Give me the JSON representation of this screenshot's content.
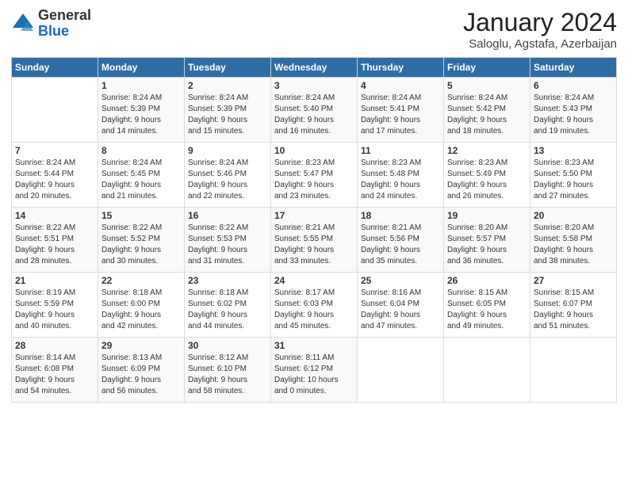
{
  "logo": {
    "general": "General",
    "blue": "Blue"
  },
  "header": {
    "month": "January 2024",
    "location": "Saloglu, Agstafa, Azerbaijan"
  },
  "days_header": [
    "Sunday",
    "Monday",
    "Tuesday",
    "Wednesday",
    "Thursday",
    "Friday",
    "Saturday"
  ],
  "weeks": [
    [
      {
        "day": "",
        "sunrise": "",
        "sunset": "",
        "daylight": ""
      },
      {
        "day": "1",
        "sunrise": "Sunrise: 8:24 AM",
        "sunset": "Sunset: 5:39 PM",
        "daylight": "Daylight: 9 hours and 14 minutes."
      },
      {
        "day": "2",
        "sunrise": "Sunrise: 8:24 AM",
        "sunset": "Sunset: 5:39 PM",
        "daylight": "Daylight: 9 hours and 15 minutes."
      },
      {
        "day": "3",
        "sunrise": "Sunrise: 8:24 AM",
        "sunset": "Sunset: 5:40 PM",
        "daylight": "Daylight: 9 hours and 16 minutes."
      },
      {
        "day": "4",
        "sunrise": "Sunrise: 8:24 AM",
        "sunset": "Sunset: 5:41 PM",
        "daylight": "Daylight: 9 hours and 17 minutes."
      },
      {
        "day": "5",
        "sunrise": "Sunrise: 8:24 AM",
        "sunset": "Sunset: 5:42 PM",
        "daylight": "Daylight: 9 hours and 18 minutes."
      },
      {
        "day": "6",
        "sunrise": "Sunrise: 8:24 AM",
        "sunset": "Sunset: 5:43 PM",
        "daylight": "Daylight: 9 hours and 19 minutes."
      }
    ],
    [
      {
        "day": "7",
        "sunrise": "Sunrise: 8:24 AM",
        "sunset": "Sunset: 5:44 PM",
        "daylight": "Daylight: 9 hours and 20 minutes."
      },
      {
        "day": "8",
        "sunrise": "Sunrise: 8:24 AM",
        "sunset": "Sunset: 5:45 PM",
        "daylight": "Daylight: 9 hours and 21 minutes."
      },
      {
        "day": "9",
        "sunrise": "Sunrise: 8:24 AM",
        "sunset": "Sunset: 5:46 PM",
        "daylight": "Daylight: 9 hours and 22 minutes."
      },
      {
        "day": "10",
        "sunrise": "Sunrise: 8:23 AM",
        "sunset": "Sunset: 5:47 PM",
        "daylight": "Daylight: 9 hours and 23 minutes."
      },
      {
        "day": "11",
        "sunrise": "Sunrise: 8:23 AM",
        "sunset": "Sunset: 5:48 PM",
        "daylight": "Daylight: 9 hours and 24 minutes."
      },
      {
        "day": "12",
        "sunrise": "Sunrise: 8:23 AM",
        "sunset": "Sunset: 5:49 PM",
        "daylight": "Daylight: 9 hours and 26 minutes."
      },
      {
        "day": "13",
        "sunrise": "Sunrise: 8:23 AM",
        "sunset": "Sunset: 5:50 PM",
        "daylight": "Daylight: 9 hours and 27 minutes."
      }
    ],
    [
      {
        "day": "14",
        "sunrise": "Sunrise: 8:22 AM",
        "sunset": "Sunset: 5:51 PM",
        "daylight": "Daylight: 9 hours and 28 minutes."
      },
      {
        "day": "15",
        "sunrise": "Sunrise: 8:22 AM",
        "sunset": "Sunset: 5:52 PM",
        "daylight": "Daylight: 9 hours and 30 minutes."
      },
      {
        "day": "16",
        "sunrise": "Sunrise: 8:22 AM",
        "sunset": "Sunset: 5:53 PM",
        "daylight": "Daylight: 9 hours and 31 minutes."
      },
      {
        "day": "17",
        "sunrise": "Sunrise: 8:21 AM",
        "sunset": "Sunset: 5:55 PM",
        "daylight": "Daylight: 9 hours and 33 minutes."
      },
      {
        "day": "18",
        "sunrise": "Sunrise: 8:21 AM",
        "sunset": "Sunset: 5:56 PM",
        "daylight": "Daylight: 9 hours and 35 minutes."
      },
      {
        "day": "19",
        "sunrise": "Sunrise: 8:20 AM",
        "sunset": "Sunset: 5:57 PM",
        "daylight": "Daylight: 9 hours and 36 minutes."
      },
      {
        "day": "20",
        "sunrise": "Sunrise: 8:20 AM",
        "sunset": "Sunset: 5:58 PM",
        "daylight": "Daylight: 9 hours and 38 minutes."
      }
    ],
    [
      {
        "day": "21",
        "sunrise": "Sunrise: 8:19 AM",
        "sunset": "Sunset: 5:59 PM",
        "daylight": "Daylight: 9 hours and 40 minutes."
      },
      {
        "day": "22",
        "sunrise": "Sunrise: 8:18 AM",
        "sunset": "Sunset: 6:00 PM",
        "daylight": "Daylight: 9 hours and 42 minutes."
      },
      {
        "day": "23",
        "sunrise": "Sunrise: 8:18 AM",
        "sunset": "Sunset: 6:02 PM",
        "daylight": "Daylight: 9 hours and 44 minutes."
      },
      {
        "day": "24",
        "sunrise": "Sunrise: 8:17 AM",
        "sunset": "Sunset: 6:03 PM",
        "daylight": "Daylight: 9 hours and 45 minutes."
      },
      {
        "day": "25",
        "sunrise": "Sunrise: 8:16 AM",
        "sunset": "Sunset: 6:04 PM",
        "daylight": "Daylight: 9 hours and 47 minutes."
      },
      {
        "day": "26",
        "sunrise": "Sunrise: 8:15 AM",
        "sunset": "Sunset: 6:05 PM",
        "daylight": "Daylight: 9 hours and 49 minutes."
      },
      {
        "day": "27",
        "sunrise": "Sunrise: 8:15 AM",
        "sunset": "Sunset: 6:07 PM",
        "daylight": "Daylight: 9 hours and 51 minutes."
      }
    ],
    [
      {
        "day": "28",
        "sunrise": "Sunrise: 8:14 AM",
        "sunset": "Sunset: 6:08 PM",
        "daylight": "Daylight: 9 hours and 54 minutes."
      },
      {
        "day": "29",
        "sunrise": "Sunrise: 8:13 AM",
        "sunset": "Sunset: 6:09 PM",
        "daylight": "Daylight: 9 hours and 56 minutes."
      },
      {
        "day": "30",
        "sunrise": "Sunrise: 8:12 AM",
        "sunset": "Sunset: 6:10 PM",
        "daylight": "Daylight: 9 hours and 58 minutes."
      },
      {
        "day": "31",
        "sunrise": "Sunrise: 8:11 AM",
        "sunset": "Sunset: 6:12 PM",
        "daylight": "Daylight: 10 hours and 0 minutes."
      },
      {
        "day": "",
        "sunrise": "",
        "sunset": "",
        "daylight": ""
      },
      {
        "day": "",
        "sunrise": "",
        "sunset": "",
        "daylight": ""
      },
      {
        "day": "",
        "sunrise": "",
        "sunset": "",
        "daylight": ""
      }
    ]
  ]
}
